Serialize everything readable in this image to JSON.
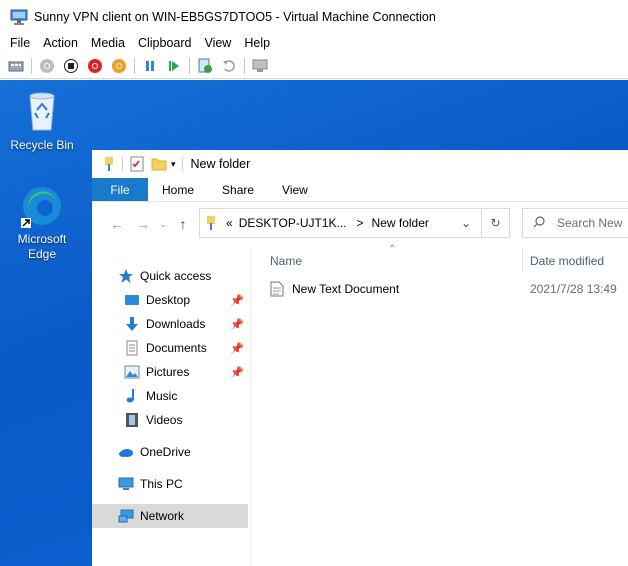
{
  "vm": {
    "title": "Sunny VPN client on WIN-EB5GS7DTOO5 - Virtual Machine Connection",
    "menu": [
      "File",
      "Action",
      "Media",
      "Clipboard",
      "View",
      "Help"
    ],
    "toolbar_icons": [
      "ctrl-alt-del-icon",
      "start-icon",
      "turn-off-icon",
      "shutdown-icon",
      "power-icon",
      "pause-icon",
      "resume-icon",
      "checkpoint-icon",
      "revert-icon",
      "enhanced-session-icon"
    ]
  },
  "desktop": {
    "icons": [
      {
        "label": "Recycle Bin",
        "icon": "recycle-bin-icon"
      },
      {
        "label": "Microsoft\nEdge",
        "label_line1": "Microsoft",
        "label_line2": "Edge",
        "icon": "edge-icon"
      }
    ]
  },
  "explorer": {
    "title": "New folder",
    "ribbon_tabs": {
      "file": "File",
      "home": "Home",
      "share": "Share",
      "view": "View"
    },
    "address": {
      "prefix": "«",
      "segment1": "DESKTOP-UJT1K...",
      "separator": ">",
      "segment2": "New folder"
    },
    "search_placeholder": "Search New",
    "nav": {
      "quick_access": "Quick access",
      "desktop": "Desktop",
      "downloads": "Downloads",
      "documents": "Documents",
      "pictures": "Pictures",
      "music": "Music",
      "videos": "Videos",
      "onedrive": "OneDrive",
      "this_pc": "This PC",
      "network": "Network"
    },
    "columns": {
      "name": "Name",
      "date_modified": "Date modified"
    },
    "files": [
      {
        "name": "New Text Document",
        "date": "2021/7/28 13:49"
      }
    ],
    "colors": {
      "file_tab": "#1979ca",
      "desktop": "#0b63d2",
      "selected": "#d9d9d9"
    }
  }
}
